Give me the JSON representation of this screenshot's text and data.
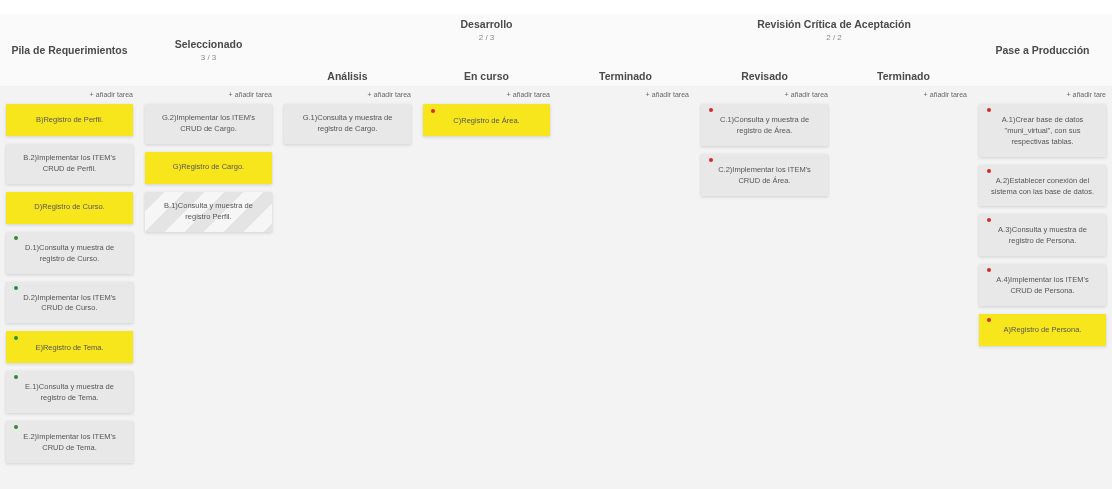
{
  "stages": [
    {
      "title": "Pila de Requerimientos",
      "columns": [
        {
          "add_label": "+ añadir tarea",
          "cards": [
            {
              "text": "B)Registro de Perfil.",
              "highlighted": true,
              "hatched": false
            },
            {
              "text": "B.2)Implementar los ITEM's CRUD de Perfil.",
              "highlighted": false,
              "hatched": false
            },
            {
              "text": "D)Registro de Curso.",
              "highlighted": true,
              "hatched": false
            },
            {
              "text": "D.1)Consulta y muestra de registro de Curso.",
              "highlighted": false,
              "hatched": false,
              "color": "#2e8b3a"
            },
            {
              "text": "D.2)Implementar los ITEM's CRUD de Curso.",
              "highlighted": false,
              "hatched": false,
              "color": "#2e8b3a"
            },
            {
              "text": "E)Registro de Tema.",
              "highlighted": true,
              "hatched": false,
              "color": "#2e8b3a"
            },
            {
              "text": "E.1)Consulta y muestra de registro de Tema.",
              "highlighted": false,
              "hatched": false,
              "color": "#2e8b3a"
            },
            {
              "text": "E.2)Implementar los ITEM's CRUD de Tema.",
              "highlighted": false,
              "hatched": false,
              "color": "#2e8b3a"
            }
          ]
        }
      ]
    },
    {
      "title": "Seleccionado",
      "count": "3 / 3",
      "columns": [
        {
          "add_label": "+ añadir tarea",
          "cards": [
            {
              "text": "G.2)Implementar los ITEM's CRUD de Cargo.",
              "highlighted": false,
              "hatched": false
            },
            {
              "text": "G)Registro de Cargo.",
              "highlighted": true,
              "hatched": false
            },
            {
              "text": "B.1)Consulta y muestra de registro Perfil.",
              "highlighted": false,
              "hatched": true
            }
          ]
        }
      ]
    },
    {
      "title": "Desarrollo",
      "count": "2 / 3",
      "columns": [
        {
          "title": "Análisis",
          "add_label": "+ añadir tarea",
          "cards": [
            {
              "text": "G.1)Consulta y muestra de registro de Cargo.",
              "highlighted": false,
              "hatched": false
            }
          ]
        },
        {
          "title": "En curso",
          "add_label": "+ añadir tarea",
          "cards": [
            {
              "text": "C)Registro de Área.",
              "highlighted": true,
              "hatched": false,
              "color": "#d42a2a"
            }
          ]
        },
        {
          "title": "Terminado",
          "add_label": "+ añadir tarea"
        }
      ]
    },
    {
      "title": "Revisión Crítica de Aceptación",
      "count": "2 / 2",
      "columns": [
        {
          "title": "Revisado",
          "add_label": "+ añadir tarea",
          "cards": [
            {
              "text": "C.1)Consulta y muestra de registro de Área.",
              "highlighted": false,
              "hatched": false,
              "color": "#d42a2a"
            },
            {
              "text": "C.2)Implementar los ITEM's CRUD de Área.",
              "highlighted": false,
              "hatched": false,
              "color": "#d42a2a"
            }
          ]
        },
        {
          "title": "Terminado",
          "add_label": "+ añadir tarea"
        }
      ]
    },
    {
      "title": "Pase a Producción",
      "columns": [
        {
          "add_label": "+ añadir tare",
          "cards": [
            {
              "text": "A.1)Crear base de datos \"muni_virtual\", con sus respectivas tablas.",
              "highlighted": false,
              "hatched": false,
              "color": "#d42a2a"
            },
            {
              "text": "A.2)Establecer conexión del sistema con las base de datos.",
              "highlighted": false,
              "hatched": false,
              "color": "#d42a2a"
            },
            {
              "text": "A.3)Consulta y muestra de registro de Persona.",
              "highlighted": false,
              "hatched": false,
              "color": "#d42a2a"
            },
            {
              "text": "A.4)Implementar los ITEM's CRUD de Persona.",
              "highlighted": false,
              "hatched": false,
              "color": "#d42a2a"
            },
            {
              "text": "A)Registro de Persona.",
              "highlighted": true,
              "hatched": false,
              "color": "#d42a2a"
            }
          ]
        }
      ]
    }
  ]
}
